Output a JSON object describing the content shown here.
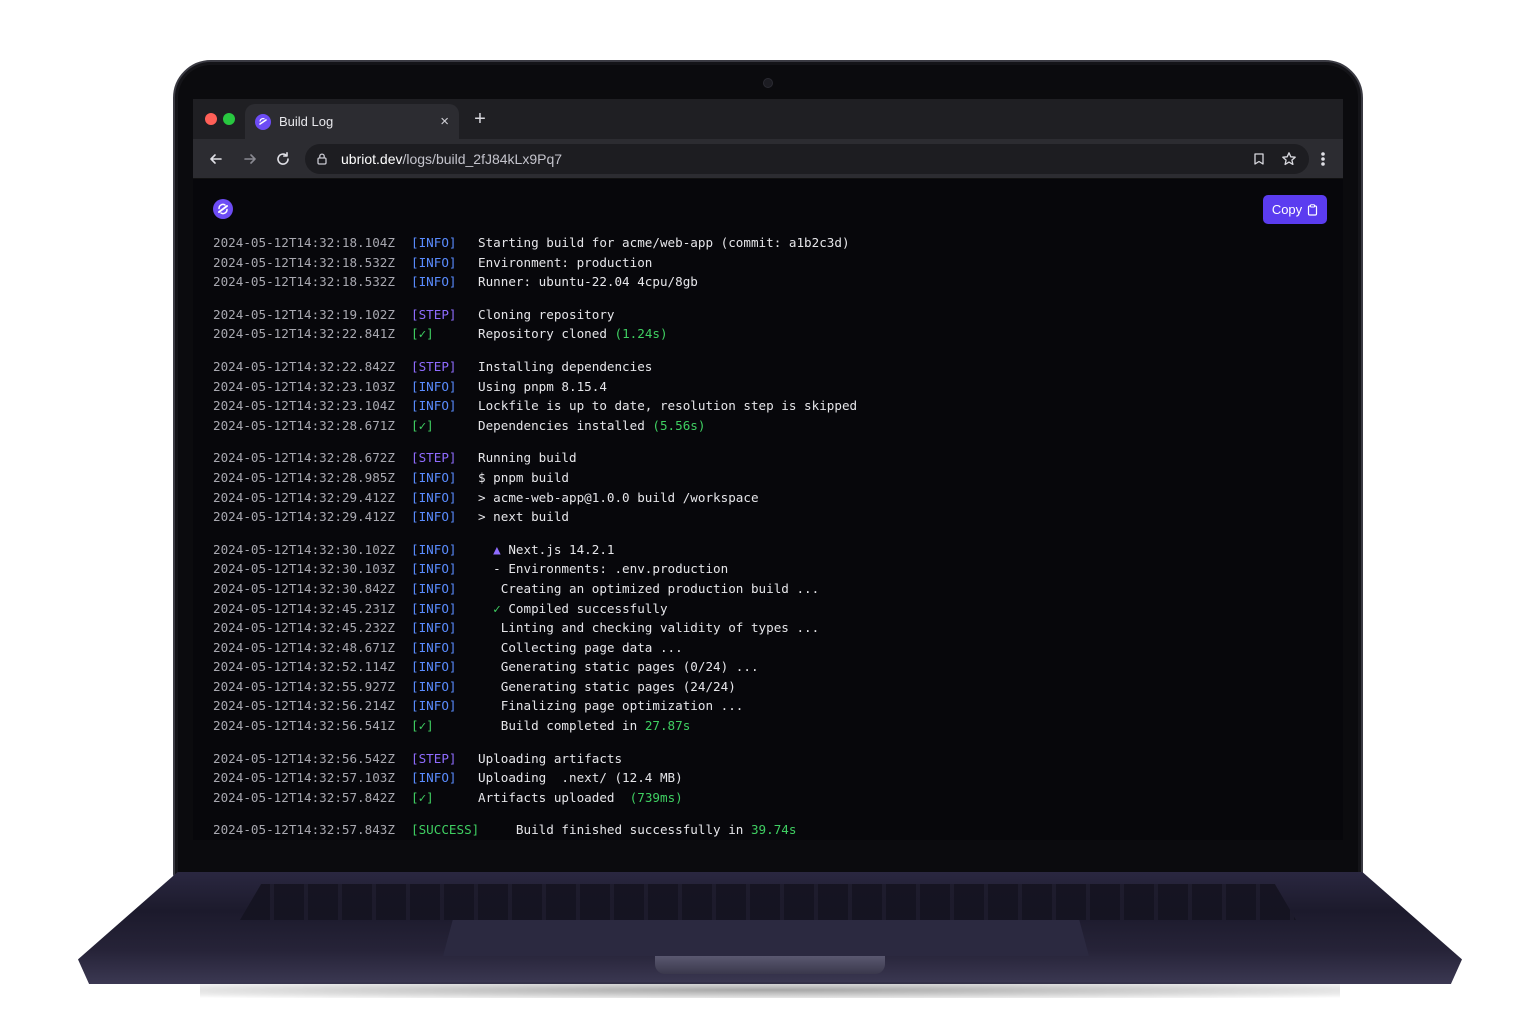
{
  "browser": {
    "tab_title": "Build Log",
    "tab_close": "×",
    "new_tab": "+",
    "url_host": "ubriot.dev",
    "url_path": "/logs/build_2fJ84kLx9Pq7"
  },
  "page": {
    "copy_label": "Copy"
  },
  "colors": {
    "accent": "#5b3cf0",
    "info": "#5a8cff",
    "step": "#8f6cff",
    "ok": "#3fcf62"
  },
  "log": [
    {
      "ts": "2024-05-12T14:32:18.104Z",
      "lvl": "[INFO]",
      "msg": "Starting build for acme/web-app (commit: a1b2c3d)"
    },
    {
      "ts": "2024-05-12T14:32:18.532Z",
      "lvl": "[INFO]",
      "msg": "Environment: production"
    },
    {
      "ts": "2024-05-12T14:32:18.532Z",
      "lvl": "[INFO]",
      "msg": "Runner: ubuntu-22.04 4cpu/8gb"
    },
    {
      "ts": "2024-05-12T14:32:19.102Z",
      "lvl": "[STEP]",
      "msg": "Cloning repository"
    },
    {
      "ts": "2024-05-12T14:32:22.841Z",
      "lvl": "[✓]",
      "msg": "Repository cloned ",
      "hl": "(1.24s)"
    },
    {
      "ts": "2024-05-12T14:32:22.842Z",
      "lvl": "[STEP]",
      "msg": "Installing dependencies"
    },
    {
      "ts": "2024-05-12T14:32:23.103Z",
      "lvl": "[INFO]",
      "msg": "Using pnpm 8.15.4"
    },
    {
      "ts": "2024-05-12T14:32:23.104Z",
      "lvl": "[INFO]",
      "msg": "Lockfile is up to date, resolution step is skipped"
    },
    {
      "ts": "2024-05-12T14:32:28.671Z",
      "lvl": "[✓]",
      "msg": "Dependencies installed ",
      "hl": "(5.56s)"
    },
    {
      "ts": "2024-05-12T14:32:28.672Z",
      "lvl": "[STEP]",
      "msg": "Running build"
    },
    {
      "ts": "2024-05-12T14:32:28.985Z",
      "lvl": "[INFO]",
      "msg": "$ pnpm build"
    },
    {
      "ts": "2024-05-12T14:32:29.412Z",
      "lvl": "[INFO]",
      "msg": "> acme-web-app@1.0.0 build /workspace"
    },
    {
      "ts": "2024-05-12T14:32:29.412Z",
      "lvl": "[INFO]",
      "msg": "> next build"
    },
    {
      "ts": "2024-05-12T14:32:30.102Z",
      "lvl": "[INFO]",
      "pre": "  ▲",
      "msg": " Next.js 14.2.1"
    },
    {
      "ts": "2024-05-12T14:32:30.103Z",
      "lvl": "[INFO]",
      "msg": "  - Environments: .env.production"
    },
    {
      "ts": "2024-05-12T14:32:30.842Z",
      "lvl": "[INFO]",
      "msg": "   Creating an optimized production build ..."
    },
    {
      "ts": "2024-05-12T14:32:45.231Z",
      "lvl": "[INFO]",
      "pre": "  ✓",
      "msg": " Compiled successfully"
    },
    {
      "ts": "2024-05-12T14:32:45.232Z",
      "lvl": "[INFO]",
      "msg": "   Linting and checking validity of types ..."
    },
    {
      "ts": "2024-05-12T14:32:48.671Z",
      "lvl": "[INFO]",
      "msg": "   Collecting page data ..."
    },
    {
      "ts": "2024-05-12T14:32:52.114Z",
      "lvl": "[INFO]",
      "msg": "   Generating static pages (0/24) ..."
    },
    {
      "ts": "2024-05-12T14:32:55.927Z",
      "lvl": "[INFO]",
      "msg": "   Generating static pages (24/24)"
    },
    {
      "ts": "2024-05-12T14:32:56.214Z",
      "lvl": "[INFO]",
      "msg": "   Finalizing page optimization ..."
    },
    {
      "ts": "2024-05-12T14:32:56.541Z",
      "lvl": "[✓]",
      "msg": "   Build completed in ",
      "hl": "27.87s"
    },
    {
      "ts": "2024-05-12T14:32:56.542Z",
      "lvl": "[STEP]",
      "msg": "Uploading artifacts"
    },
    {
      "ts": "2024-05-12T14:32:57.103Z",
      "lvl": "[INFO]",
      "msg": "Uploading  .next/ (12.4 MB)"
    },
    {
      "ts": "2024-05-12T14:32:57.842Z",
      "lvl": "[✓]",
      "msg": "Artifacts uploaded  ",
      "hl": "(739ms)"
    },
    {
      "ts": "2024-05-12T14:32:57.843Z",
      "lvl": "[SUCCESS]",
      "msg": "     Build finished successfully in ",
      "hl": "39.74s"
    }
  ]
}
